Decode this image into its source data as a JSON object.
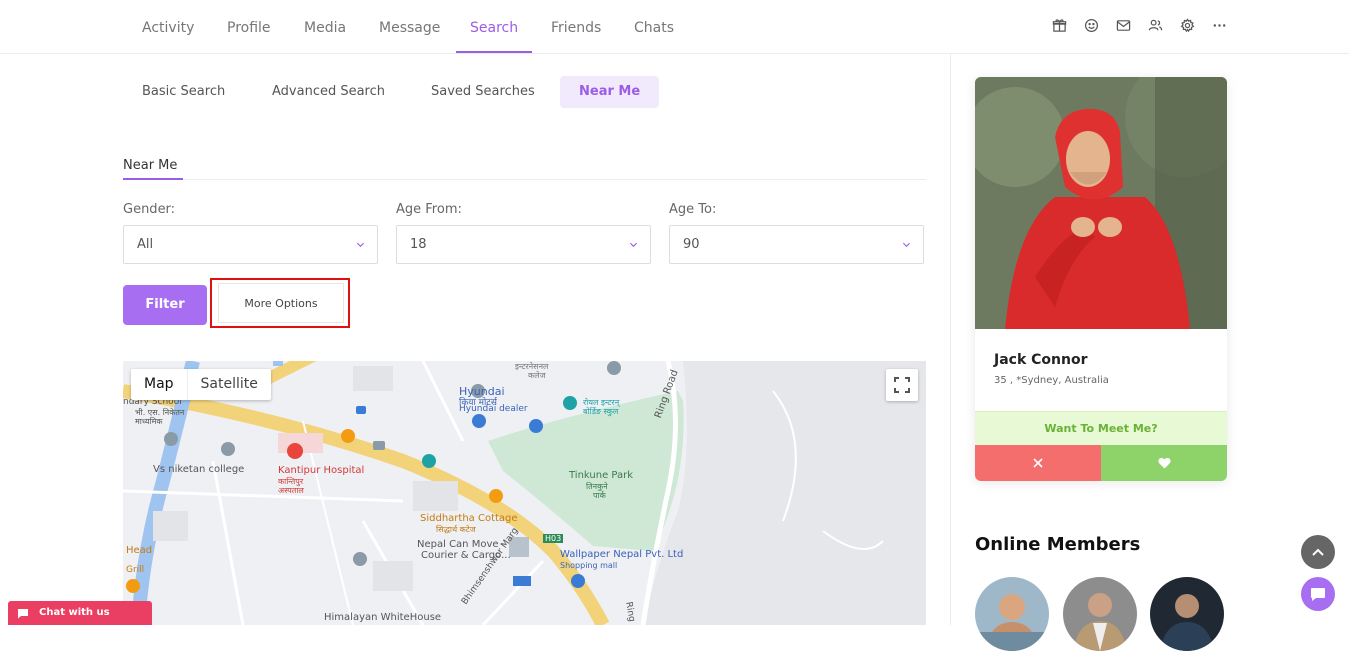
{
  "topnav": {
    "tabs": [
      {
        "label": "Activity"
      },
      {
        "label": "Profile"
      },
      {
        "label": "Media"
      },
      {
        "label": "Message"
      },
      {
        "label": "Search"
      },
      {
        "label": "Friends"
      },
      {
        "label": "Chats"
      }
    ],
    "active_tab": "Search",
    "icons": [
      "gift-icon",
      "smiley-icon",
      "mail-icon",
      "users-icon",
      "gear-icon",
      "more-icon"
    ]
  },
  "subtabs": [
    {
      "label": "Basic Search"
    },
    {
      "label": "Advanced Search"
    },
    {
      "label": "Saved Searches"
    },
    {
      "label": "Near Me"
    }
  ],
  "active_subtab": "Near Me",
  "section": {
    "title": "Near Me"
  },
  "filters": {
    "gender": {
      "label": "Gender:",
      "value": "All"
    },
    "age_from": {
      "label": "Age From:",
      "value": "18"
    },
    "age_to": {
      "label": "Age To:",
      "value": "90"
    },
    "filter_label": "Filter",
    "more_options_label": "More Options"
  },
  "map": {
    "toggle_map": "Map",
    "toggle_satellite": "Satellite",
    "labels": {
      "hyundai": "Hyundai",
      "hyundai_np": "हयुण्डाइ",
      "hyundai_dealer": "Hyundai dealer",
      "school": "ndary School",
      "school_np1": "भी. एस. निकेतन",
      "school_np2": "माध्यमिक",
      "vs_college": "Vs niketan college",
      "kantipur": "Kantipur Hospital",
      "kantipur_np1": "कान्तिपुर",
      "kantipur_np2": "अस्पताल",
      "tinkune": "Tinkune Park",
      "tinkune_np1": "तिनकुने",
      "tinkune_np2": "पार्क",
      "ring_road": "Ring Road",
      "ring_road2": "Ring",
      "siddhartha": "Siddhartha Cottage",
      "siddhartha_np": "सिद्धार्थ कटेज",
      "nepal_can1": "Nepal Can Move -",
      "nepal_can2": "Courier & Cargo...",
      "wallpaper": "Wallpaper Nepal Pvt. Ltd",
      "shopping": "Shopping mall",
      "head1": "Head",
      "head2": "Grill",
      "himalayan": "Himalayan WhiteHouse",
      "road_shield": "H03",
      "college_np": "इन्टरनेसनल",
      "college_np2": "कलेज",
      "hyundai_np2": "किया मोटर्स",
      "royal1": "रोयल इन्टरन्",
      "royal2": "बोर्डिङ स्कुल",
      "marg": "Bhimsenshwor Marg"
    }
  },
  "member_card": {
    "name": "Jack Connor",
    "sub": "35 , *Sydney, Australia",
    "meet_label": "Want To Meet Me?",
    "no_icon": "close-icon",
    "yes_icon": "heart-icon"
  },
  "online": {
    "title": "Online Members"
  },
  "chat_us": {
    "label": "Chat with us"
  },
  "colors": {
    "accent": "#9b5de5",
    "filter_button": "#a86ef2",
    "highlight_box": "#e01010",
    "meet_green": "#69b235",
    "no_red": "#f46e6e",
    "yes_green": "#8dd36a",
    "chat_us_pink": "#ea3e62"
  }
}
